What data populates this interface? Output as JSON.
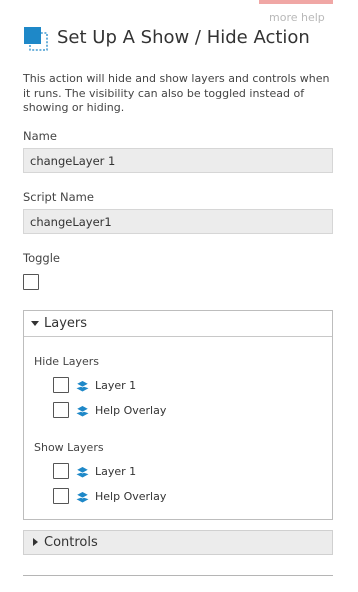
{
  "header": {
    "more_help": "more help",
    "title": "Set Up A Show / Hide Action",
    "icon": "show-hide-action-icon",
    "accent_color": "#f0a7a5",
    "icon_color": "#1e88c8"
  },
  "description": "This action will hide and show layers and controls when it runs. The visibility can also be toggled instead of showing or hiding.",
  "fields": {
    "name": {
      "label": "Name",
      "value": "changeLayer 1"
    },
    "script_name": {
      "label": "Script Name",
      "value": "changeLayer1"
    },
    "toggle": {
      "label": "Toggle",
      "checked": false
    }
  },
  "layers_panel": {
    "title": "Layers",
    "expanded": true,
    "hide_layers": {
      "label": "Hide Layers",
      "items": [
        {
          "name": "Layer 1",
          "checked": false,
          "icon": "layers-icon"
        },
        {
          "name": "Help Overlay",
          "checked": false,
          "icon": "layers-icon"
        }
      ]
    },
    "show_layers": {
      "label": "Show Layers",
      "items": [
        {
          "name": "Layer 1",
          "checked": false,
          "icon": "layers-icon"
        },
        {
          "name": "Help Overlay",
          "checked": false,
          "icon": "layers-icon"
        }
      ]
    }
  },
  "controls_panel": {
    "title": "Controls",
    "expanded": false
  }
}
